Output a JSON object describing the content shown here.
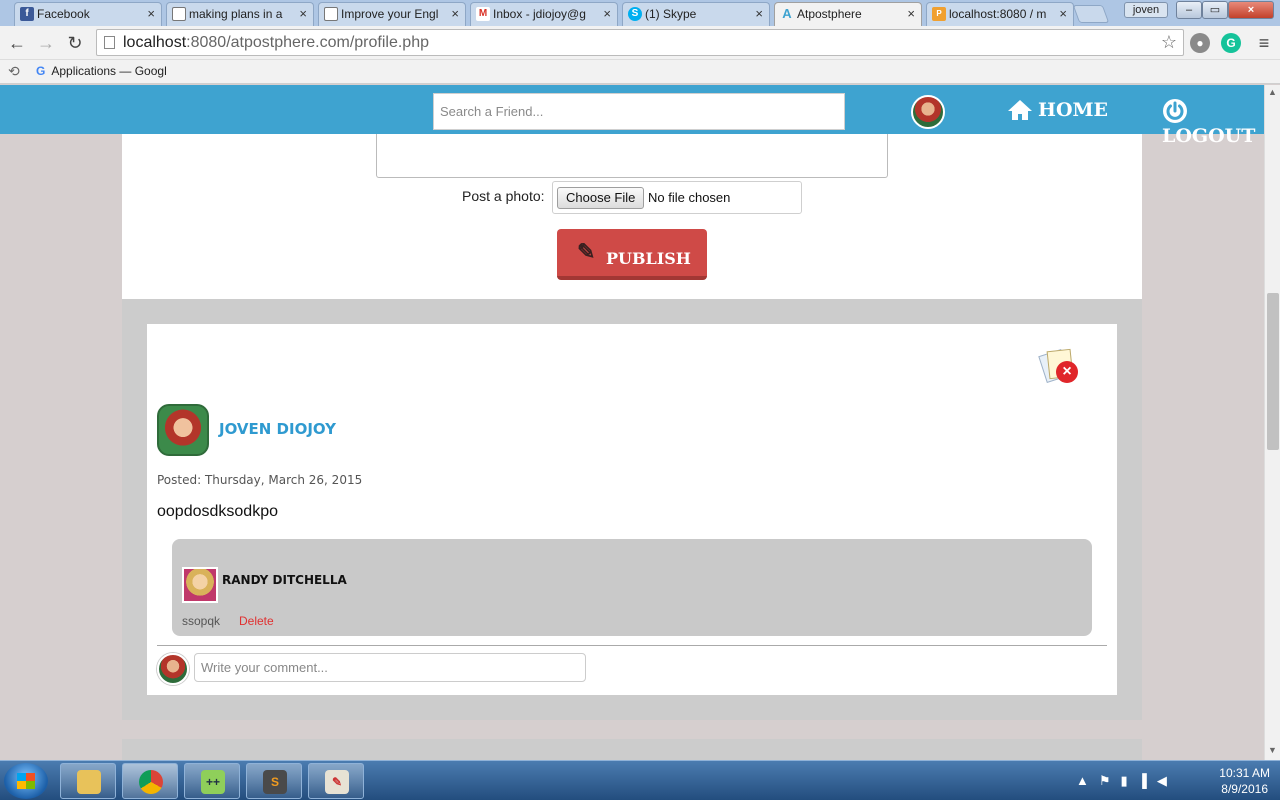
{
  "browser": {
    "tabs": [
      {
        "label": "Facebook",
        "icon": "f",
        "color": "#3b5998"
      },
      {
        "label": "making plans in a",
        "icon": "",
        "color": "#ffffff"
      },
      {
        "label": "Improve your Engl",
        "icon": "",
        "color": "#ffffff"
      },
      {
        "label": "Inbox - jdiojoy@g",
        "icon": "M",
        "color": "#d93025"
      },
      {
        "label": "(1) Skype",
        "icon": "S",
        "color": "#00aff0"
      },
      {
        "label": "Atpostphere",
        "icon": "A",
        "color": "#3ea3d0"
      },
      {
        "label": "localhost:8080 / m",
        "icon": "P",
        "color": "#f0a030"
      }
    ],
    "user_badge": "joven",
    "url_host": "localhost",
    "url_rest": ":8080/atpostphere.com/profile.php",
    "bookmark_label": "Applications — Googl"
  },
  "header": {
    "search_placeholder": "Search a Friend...",
    "home_label": "HOME",
    "logout_label": "LOGOUT"
  },
  "composer": {
    "photo_label": "Post a photo:",
    "choose_file_label": "Choose File",
    "no_file_label": "No file chosen",
    "publish_label": "PUBLISH"
  },
  "post": {
    "author": "JOVEN DIOJOY",
    "posted": "Posted: Thursday, March 26, 2015",
    "text": "oopdosdksodkpo",
    "comment": {
      "author": "RANDY DITCHELLA",
      "text": "ssopqk",
      "delete_label": "Delete"
    },
    "comment_placeholder": "Write your comment..."
  },
  "taskbar": {
    "time": "10:31 AM",
    "date": "8/9/2016"
  },
  "colors": {
    "header_blue": "#3ea3d0",
    "publish_red": "#cf4a47",
    "author_blue": "#2f9ad0",
    "delete_red": "#e03030"
  }
}
